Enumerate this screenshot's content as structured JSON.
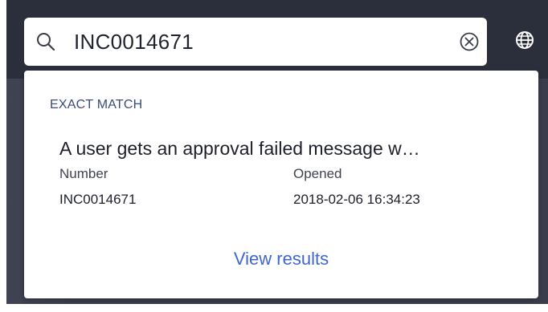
{
  "search": {
    "value": "INC0014671",
    "icon": "search-icon",
    "clear_icon": "clear-circle-icon"
  },
  "header": {
    "globe_icon": "globe-icon"
  },
  "dropdown": {
    "section_label": "EXACT MATCH",
    "result": {
      "title": "A user gets an approval failed message w…",
      "number_label": "Number",
      "number_value": "INC0014671",
      "opened_label": "Opened",
      "opened_value": "2018-02-06 16:34:23"
    },
    "view_results_label": "View results"
  },
  "colors": {
    "chrome_dark": "#2b2f3b",
    "section_label": "#3b4a7a",
    "link": "#3d65d6"
  }
}
